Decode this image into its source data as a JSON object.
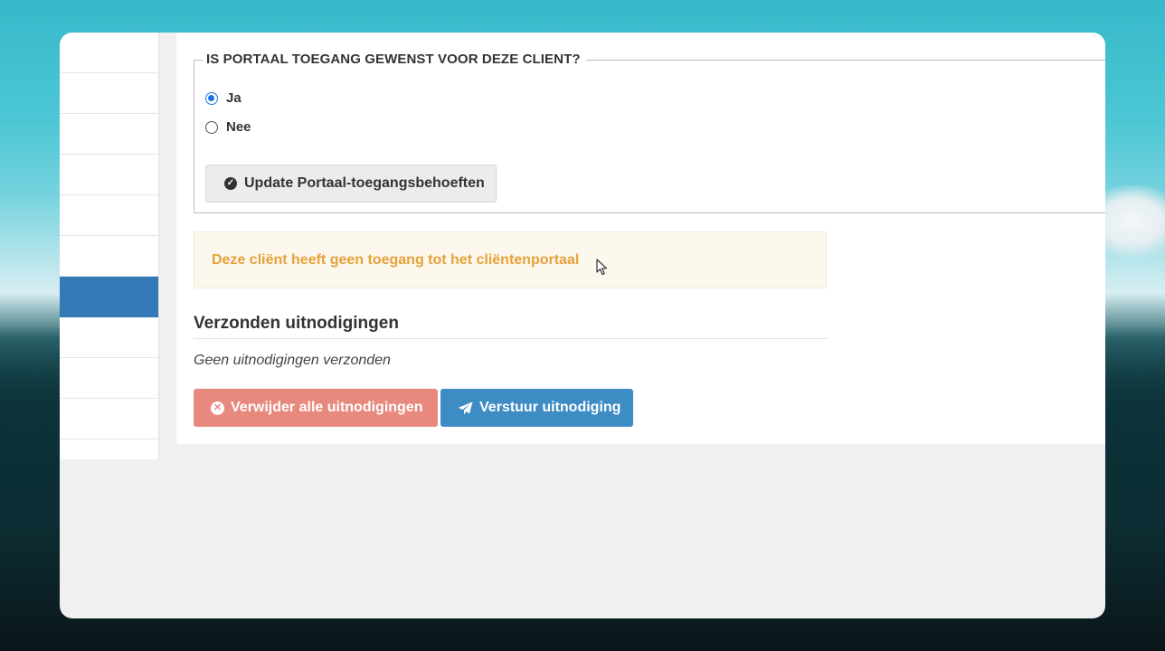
{
  "portal_access": {
    "legend": "IS PORTAAL TOEGANG GEWENST VOOR DEZE CLIENT?",
    "options": [
      {
        "label": "Ja",
        "checked": true
      },
      {
        "label": "Nee",
        "checked": false
      }
    ],
    "update_button": "Update Portaal-toegangsbehoeften"
  },
  "alert": {
    "message": "Deze cliënt heeft geen toegang tot het cliëntenportaal"
  },
  "invitations": {
    "title": "Verzonden uitnodigingen",
    "empty_text": "Geen uitnodigingen verzonden",
    "delete_button": "Verwijder alle uitnodigingen",
    "send_button": "Verstuur uitnodiging"
  },
  "sidebar": {
    "active_index": 6
  },
  "colors": {
    "primary": "#337ab7",
    "send_button": "#3d8cc4",
    "delete_button": "#e8897e",
    "warning_text": "#e6a13a",
    "radio_checked": "#1a73e8"
  }
}
